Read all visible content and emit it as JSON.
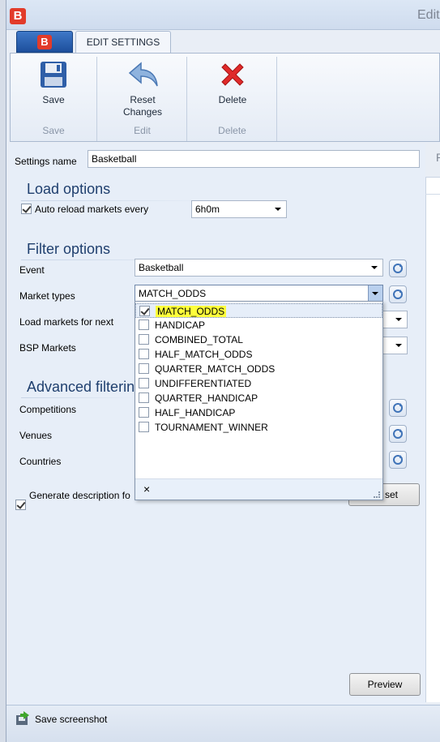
{
  "window": {
    "title": "Edit",
    "tab_edit_settings": "EDIT SETTINGS"
  },
  "ribbon": {
    "save": {
      "label": "Save",
      "group": "Save"
    },
    "reset": {
      "label_line1": "Reset",
      "label_line2": "Changes",
      "group": "Edit"
    },
    "delete": {
      "label": "Delete",
      "group": "Delete"
    }
  },
  "form": {
    "settings_name_label": "Settings name",
    "settings_name_value": "Basketball",
    "load_options_title": "Load options",
    "auto_reload_label": "Auto reload markets every",
    "auto_reload_checked": true,
    "auto_reload_value": "6h0m",
    "filter_options_title": "Filter options",
    "event_label": "Event",
    "event_value": "Basketball",
    "market_types_label": "Market types",
    "market_types_value": "MATCH_ODDS",
    "load_markets_label": "Load markets for next",
    "bsp_label": "BSP Markets",
    "advanced_title": "Advanced filtering",
    "competitions_label": "Competitions",
    "venues_label": "Venues",
    "countries_label": "Countries",
    "generate_desc_label": "Generate description fo",
    "generate_desc_checked": true,
    "reset_button_partial": "set",
    "preview_button": "Preview"
  },
  "market_dropdown": {
    "items": [
      {
        "label": "MATCH_ODDS",
        "checked": true
      },
      {
        "label": "HANDICAP",
        "checked": false
      },
      {
        "label": "COMBINED_TOTAL",
        "checked": false
      },
      {
        "label": "HALF_MATCH_ODDS",
        "checked": false
      },
      {
        "label": "QUARTER_MATCH_ODDS",
        "checked": false
      },
      {
        "label": "UNDIFFERENTIATED",
        "checked": false
      },
      {
        "label": "QUARTER_HANDICAP",
        "checked": false
      },
      {
        "label": "HALF_HANDICAP",
        "checked": false
      },
      {
        "label": "TOURNAMENT_WINNER",
        "checked": false
      }
    ],
    "close_glyph": "×"
  },
  "right_panel": {
    "title_partial": "P"
  },
  "statusbar": {
    "save_screenshot": "Save screenshot"
  },
  "colors": {
    "brand_red": "#e23b2a",
    "highlight": "#ffff3a",
    "section_title": "#1f3f6e"
  }
}
